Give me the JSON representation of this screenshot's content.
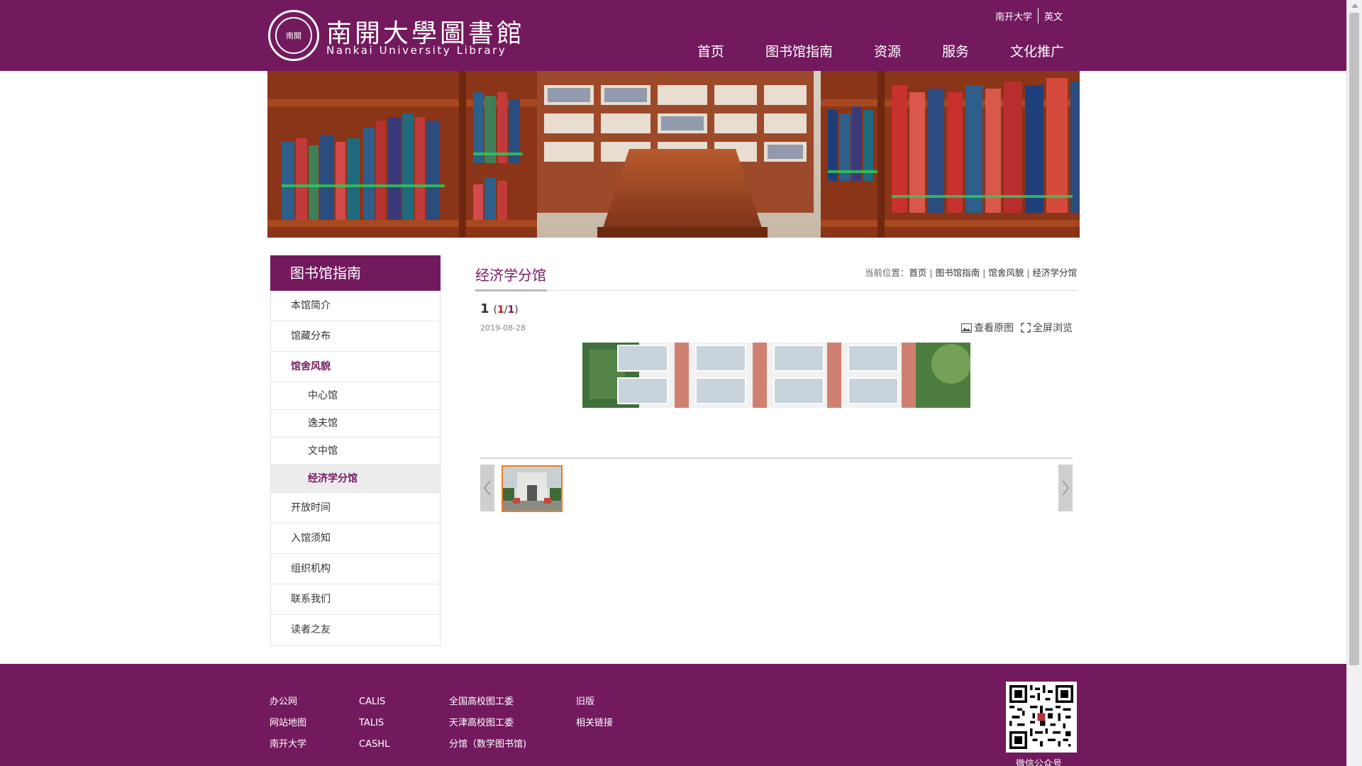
{
  "header": {
    "logo_cn": "南開大學圖書館",
    "logo_en": "Nankai University Library",
    "seal_text": "南開",
    "top_links": [
      "南开大学",
      "英文"
    ],
    "nav": [
      "首页",
      "图书馆指南",
      "资源",
      "服务",
      "文化推广"
    ]
  },
  "sidebar": {
    "title": "图书馆指南",
    "items": [
      {
        "label": "本馆简介"
      },
      {
        "label": "馆藏分布"
      },
      {
        "label": "馆舍风貌",
        "active": true
      },
      {
        "label": "中心馆",
        "sub": true
      },
      {
        "label": "逸夫馆",
        "sub": true
      },
      {
        "label": "文中馆",
        "sub": true
      },
      {
        "label": "经济学分馆",
        "sub": true,
        "active": true
      },
      {
        "label": "开放时间"
      },
      {
        "label": "入馆须知"
      },
      {
        "label": "组织机构"
      },
      {
        "label": "联系我们"
      },
      {
        "label": "读者之友"
      }
    ]
  },
  "content": {
    "title": "经济学分馆",
    "breadcrumb_prefix": "当前位置：",
    "breadcrumb": [
      "首页",
      "图书馆指南",
      "馆舍风貌",
      "经济学分馆"
    ],
    "photo_index": "1",
    "photo_count_current": "1",
    "photo_count_total": "1",
    "date": "2019-08-28",
    "tools": {
      "view_original": "查看原图",
      "fullscreen": "全屏浏览"
    }
  },
  "footer": {
    "col1": [
      "办公网",
      "网站地图",
      "南开大学"
    ],
    "col2": [
      "CALIS",
      "TALIS",
      "CASHL"
    ],
    "col3": [
      "全国高校图工委",
      "天津高校图工委",
      "分馆（数学图书馆)"
    ],
    "col4": [
      "旧版",
      "相关链接"
    ],
    "qr_label": "微信公众号"
  },
  "colors": {
    "brand": "#731a5e",
    "highlight": "#f07a1a"
  }
}
